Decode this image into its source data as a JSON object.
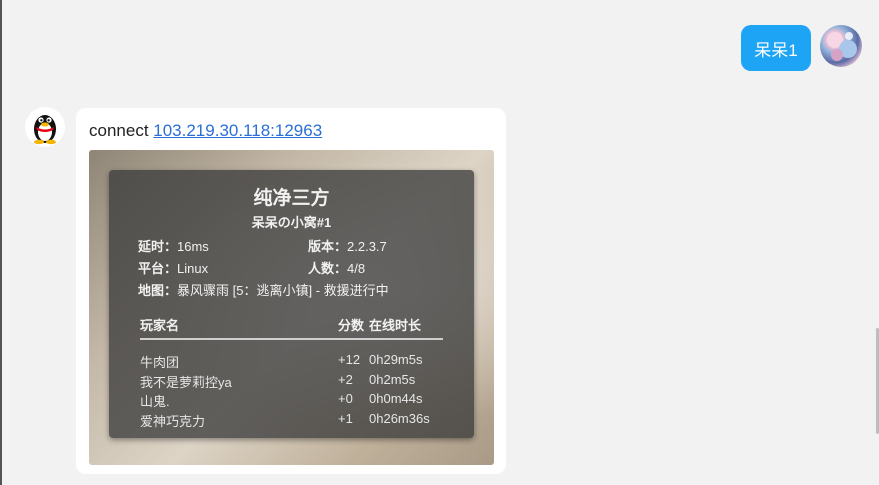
{
  "outgoing": {
    "text": "呆呆1"
  },
  "incoming": {
    "prefix": "connect ",
    "link": "103.219.30.118:12963"
  },
  "server_card": {
    "title": "纯净三方",
    "subtitle": "呆呆の小窝#1",
    "latency_label": "延时：",
    "latency_value": "16ms",
    "version_label": "版本：",
    "version_value": "2.2.3.7",
    "platform_label": "平台：",
    "platform_value": "Linux",
    "players_label": "人数：",
    "players_value": "4/8",
    "map_label": "地图：",
    "map_value": "暴风骤雨 [5：逃离小镇] - 救援进行中",
    "columns": {
      "name": "玩家名",
      "score": "分数",
      "time": "在线时长"
    },
    "players": [
      {
        "name": "牛肉团",
        "score": "+12",
        "time": "0h29m5s"
      },
      {
        "name": "我不是萝莉控ya",
        "score": "+2",
        "time": "0h2m5s"
      },
      {
        "name": "山鬼.",
        "score": "+0",
        "time": "0h0m44s"
      },
      {
        "name": "爱神巧克力",
        "score": "+1",
        "time": "0h26m36s"
      }
    ]
  },
  "colors": {
    "bubble_out": "#1ea4f5",
    "link": "#2a6fd6",
    "background": "#f2f2f2"
  },
  "icons": {
    "incoming_avatar": "qq-penguin-icon",
    "outgoing_avatar": "user-avatar"
  }
}
